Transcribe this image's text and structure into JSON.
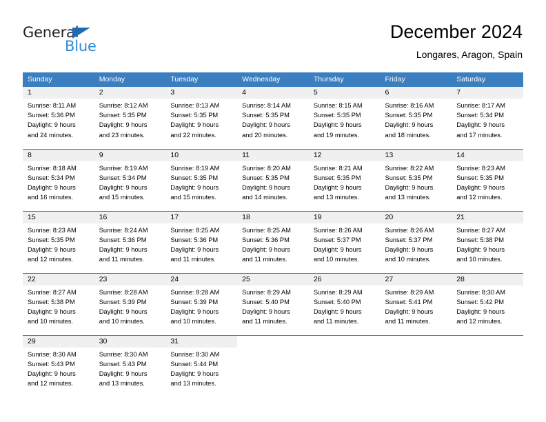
{
  "brand": {
    "name_part1": "General",
    "name_part2": "Blue",
    "triangle_icon": "triangle-icon",
    "colors": {
      "dark": "#231f20",
      "blue_text": "#2e8ad4",
      "triangle": "#1b6cb5"
    }
  },
  "header": {
    "title": "December 2024",
    "subtitle": "Longares, Aragon, Spain"
  },
  "colors": {
    "header_row_bg": "#3c7fc1",
    "header_row_text": "#ffffff",
    "daynum_band_bg": "#f0f0f0",
    "row_divider": "#3c7fc1",
    "page_bg": "#ffffff",
    "text": "#000000"
  },
  "weekdays": [
    "Sunday",
    "Monday",
    "Tuesday",
    "Wednesday",
    "Thursday",
    "Friday",
    "Saturday"
  ],
  "weeks": [
    [
      {
        "day": "1",
        "sunrise": "Sunrise: 8:11 AM",
        "sunset": "Sunset: 5:36 PM",
        "daylight_line1": "Daylight: 9 hours",
        "daylight_line2": "and 24 minutes."
      },
      {
        "day": "2",
        "sunrise": "Sunrise: 8:12 AM",
        "sunset": "Sunset: 5:35 PM",
        "daylight_line1": "Daylight: 9 hours",
        "daylight_line2": "and 23 minutes."
      },
      {
        "day": "3",
        "sunrise": "Sunrise: 8:13 AM",
        "sunset": "Sunset: 5:35 PM",
        "daylight_line1": "Daylight: 9 hours",
        "daylight_line2": "and 22 minutes."
      },
      {
        "day": "4",
        "sunrise": "Sunrise: 8:14 AM",
        "sunset": "Sunset: 5:35 PM",
        "daylight_line1": "Daylight: 9 hours",
        "daylight_line2": "and 20 minutes."
      },
      {
        "day": "5",
        "sunrise": "Sunrise: 8:15 AM",
        "sunset": "Sunset: 5:35 PM",
        "daylight_line1": "Daylight: 9 hours",
        "daylight_line2": "and 19 minutes."
      },
      {
        "day": "6",
        "sunrise": "Sunrise: 8:16 AM",
        "sunset": "Sunset: 5:35 PM",
        "daylight_line1": "Daylight: 9 hours",
        "daylight_line2": "and 18 minutes."
      },
      {
        "day": "7",
        "sunrise": "Sunrise: 8:17 AM",
        "sunset": "Sunset: 5:34 PM",
        "daylight_line1": "Daylight: 9 hours",
        "daylight_line2": "and 17 minutes."
      }
    ],
    [
      {
        "day": "8",
        "sunrise": "Sunrise: 8:18 AM",
        "sunset": "Sunset: 5:34 PM",
        "daylight_line1": "Daylight: 9 hours",
        "daylight_line2": "and 16 minutes."
      },
      {
        "day": "9",
        "sunrise": "Sunrise: 8:19 AM",
        "sunset": "Sunset: 5:34 PM",
        "daylight_line1": "Daylight: 9 hours",
        "daylight_line2": "and 15 minutes."
      },
      {
        "day": "10",
        "sunrise": "Sunrise: 8:19 AM",
        "sunset": "Sunset: 5:35 PM",
        "daylight_line1": "Daylight: 9 hours",
        "daylight_line2": "and 15 minutes."
      },
      {
        "day": "11",
        "sunrise": "Sunrise: 8:20 AM",
        "sunset": "Sunset: 5:35 PM",
        "daylight_line1": "Daylight: 9 hours",
        "daylight_line2": "and 14 minutes."
      },
      {
        "day": "12",
        "sunrise": "Sunrise: 8:21 AM",
        "sunset": "Sunset: 5:35 PM",
        "daylight_line1": "Daylight: 9 hours",
        "daylight_line2": "and 13 minutes."
      },
      {
        "day": "13",
        "sunrise": "Sunrise: 8:22 AM",
        "sunset": "Sunset: 5:35 PM",
        "daylight_line1": "Daylight: 9 hours",
        "daylight_line2": "and 13 minutes."
      },
      {
        "day": "14",
        "sunrise": "Sunrise: 8:23 AM",
        "sunset": "Sunset: 5:35 PM",
        "daylight_line1": "Daylight: 9 hours",
        "daylight_line2": "and 12 minutes."
      }
    ],
    [
      {
        "day": "15",
        "sunrise": "Sunrise: 8:23 AM",
        "sunset": "Sunset: 5:35 PM",
        "daylight_line1": "Daylight: 9 hours",
        "daylight_line2": "and 12 minutes."
      },
      {
        "day": "16",
        "sunrise": "Sunrise: 8:24 AM",
        "sunset": "Sunset: 5:36 PM",
        "daylight_line1": "Daylight: 9 hours",
        "daylight_line2": "and 11 minutes."
      },
      {
        "day": "17",
        "sunrise": "Sunrise: 8:25 AM",
        "sunset": "Sunset: 5:36 PM",
        "daylight_line1": "Daylight: 9 hours",
        "daylight_line2": "and 11 minutes."
      },
      {
        "day": "18",
        "sunrise": "Sunrise: 8:25 AM",
        "sunset": "Sunset: 5:36 PM",
        "daylight_line1": "Daylight: 9 hours",
        "daylight_line2": "and 11 minutes."
      },
      {
        "day": "19",
        "sunrise": "Sunrise: 8:26 AM",
        "sunset": "Sunset: 5:37 PM",
        "daylight_line1": "Daylight: 9 hours",
        "daylight_line2": "and 10 minutes."
      },
      {
        "day": "20",
        "sunrise": "Sunrise: 8:26 AM",
        "sunset": "Sunset: 5:37 PM",
        "daylight_line1": "Daylight: 9 hours",
        "daylight_line2": "and 10 minutes."
      },
      {
        "day": "21",
        "sunrise": "Sunrise: 8:27 AM",
        "sunset": "Sunset: 5:38 PM",
        "daylight_line1": "Daylight: 9 hours",
        "daylight_line2": "and 10 minutes."
      }
    ],
    [
      {
        "day": "22",
        "sunrise": "Sunrise: 8:27 AM",
        "sunset": "Sunset: 5:38 PM",
        "daylight_line1": "Daylight: 9 hours",
        "daylight_line2": "and 10 minutes."
      },
      {
        "day": "23",
        "sunrise": "Sunrise: 8:28 AM",
        "sunset": "Sunset: 5:39 PM",
        "daylight_line1": "Daylight: 9 hours",
        "daylight_line2": "and 10 minutes."
      },
      {
        "day": "24",
        "sunrise": "Sunrise: 8:28 AM",
        "sunset": "Sunset: 5:39 PM",
        "daylight_line1": "Daylight: 9 hours",
        "daylight_line2": "and 10 minutes."
      },
      {
        "day": "25",
        "sunrise": "Sunrise: 8:29 AM",
        "sunset": "Sunset: 5:40 PM",
        "daylight_line1": "Daylight: 9 hours",
        "daylight_line2": "and 11 minutes."
      },
      {
        "day": "26",
        "sunrise": "Sunrise: 8:29 AM",
        "sunset": "Sunset: 5:40 PM",
        "daylight_line1": "Daylight: 9 hours",
        "daylight_line2": "and 11 minutes."
      },
      {
        "day": "27",
        "sunrise": "Sunrise: 8:29 AM",
        "sunset": "Sunset: 5:41 PM",
        "daylight_line1": "Daylight: 9 hours",
        "daylight_line2": "and 11 minutes."
      },
      {
        "day": "28",
        "sunrise": "Sunrise: 8:30 AM",
        "sunset": "Sunset: 5:42 PM",
        "daylight_line1": "Daylight: 9 hours",
        "daylight_line2": "and 12 minutes."
      }
    ],
    [
      {
        "day": "29",
        "sunrise": "Sunrise: 8:30 AM",
        "sunset": "Sunset: 5:43 PM",
        "daylight_line1": "Daylight: 9 hours",
        "daylight_line2": "and 12 minutes."
      },
      {
        "day": "30",
        "sunrise": "Sunrise: 8:30 AM",
        "sunset": "Sunset: 5:43 PM",
        "daylight_line1": "Daylight: 9 hours",
        "daylight_line2": "and 13 minutes."
      },
      {
        "day": "31",
        "sunrise": "Sunrise: 8:30 AM",
        "sunset": "Sunset: 5:44 PM",
        "daylight_line1": "Daylight: 9 hours",
        "daylight_line2": "and 13 minutes."
      },
      {
        "day": "",
        "sunrise": "",
        "sunset": "",
        "daylight_line1": "",
        "daylight_line2": ""
      },
      {
        "day": "",
        "sunrise": "",
        "sunset": "",
        "daylight_line1": "",
        "daylight_line2": ""
      },
      {
        "day": "",
        "sunrise": "",
        "sunset": "",
        "daylight_line1": "",
        "daylight_line2": ""
      },
      {
        "day": "",
        "sunrise": "",
        "sunset": "",
        "daylight_line1": "",
        "daylight_line2": ""
      }
    ]
  ]
}
